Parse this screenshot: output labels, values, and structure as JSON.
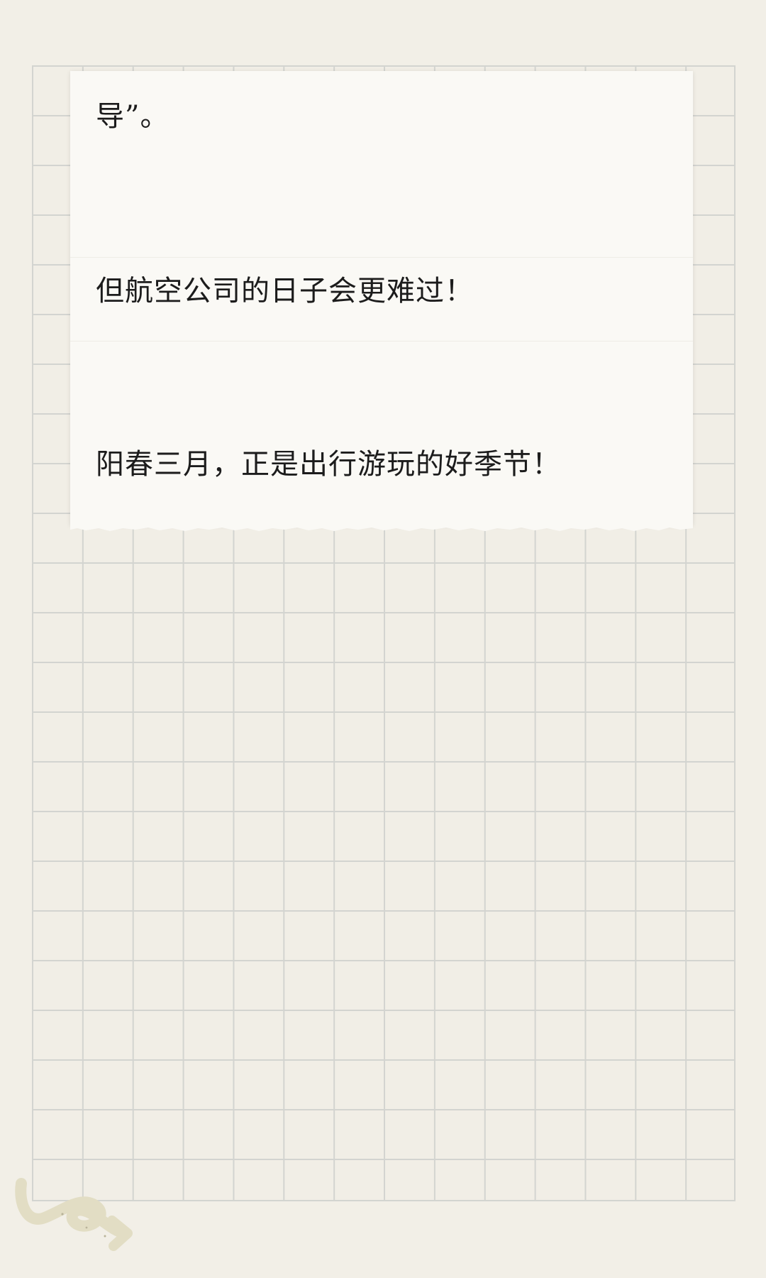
{
  "note": {
    "lines": [
      "导”。",
      "但航空公司的日子会更难过！",
      "阳春三月，正是出行游玩的好季节！"
    ]
  },
  "colors": {
    "background": "#f2efe7",
    "grid_line": "#d3d4d0",
    "card": "#faf9f5",
    "text": "#1c1c1c",
    "doodle": "#e2ddc4"
  },
  "icons": {
    "doodle": "squiggle-arrow-icon"
  }
}
